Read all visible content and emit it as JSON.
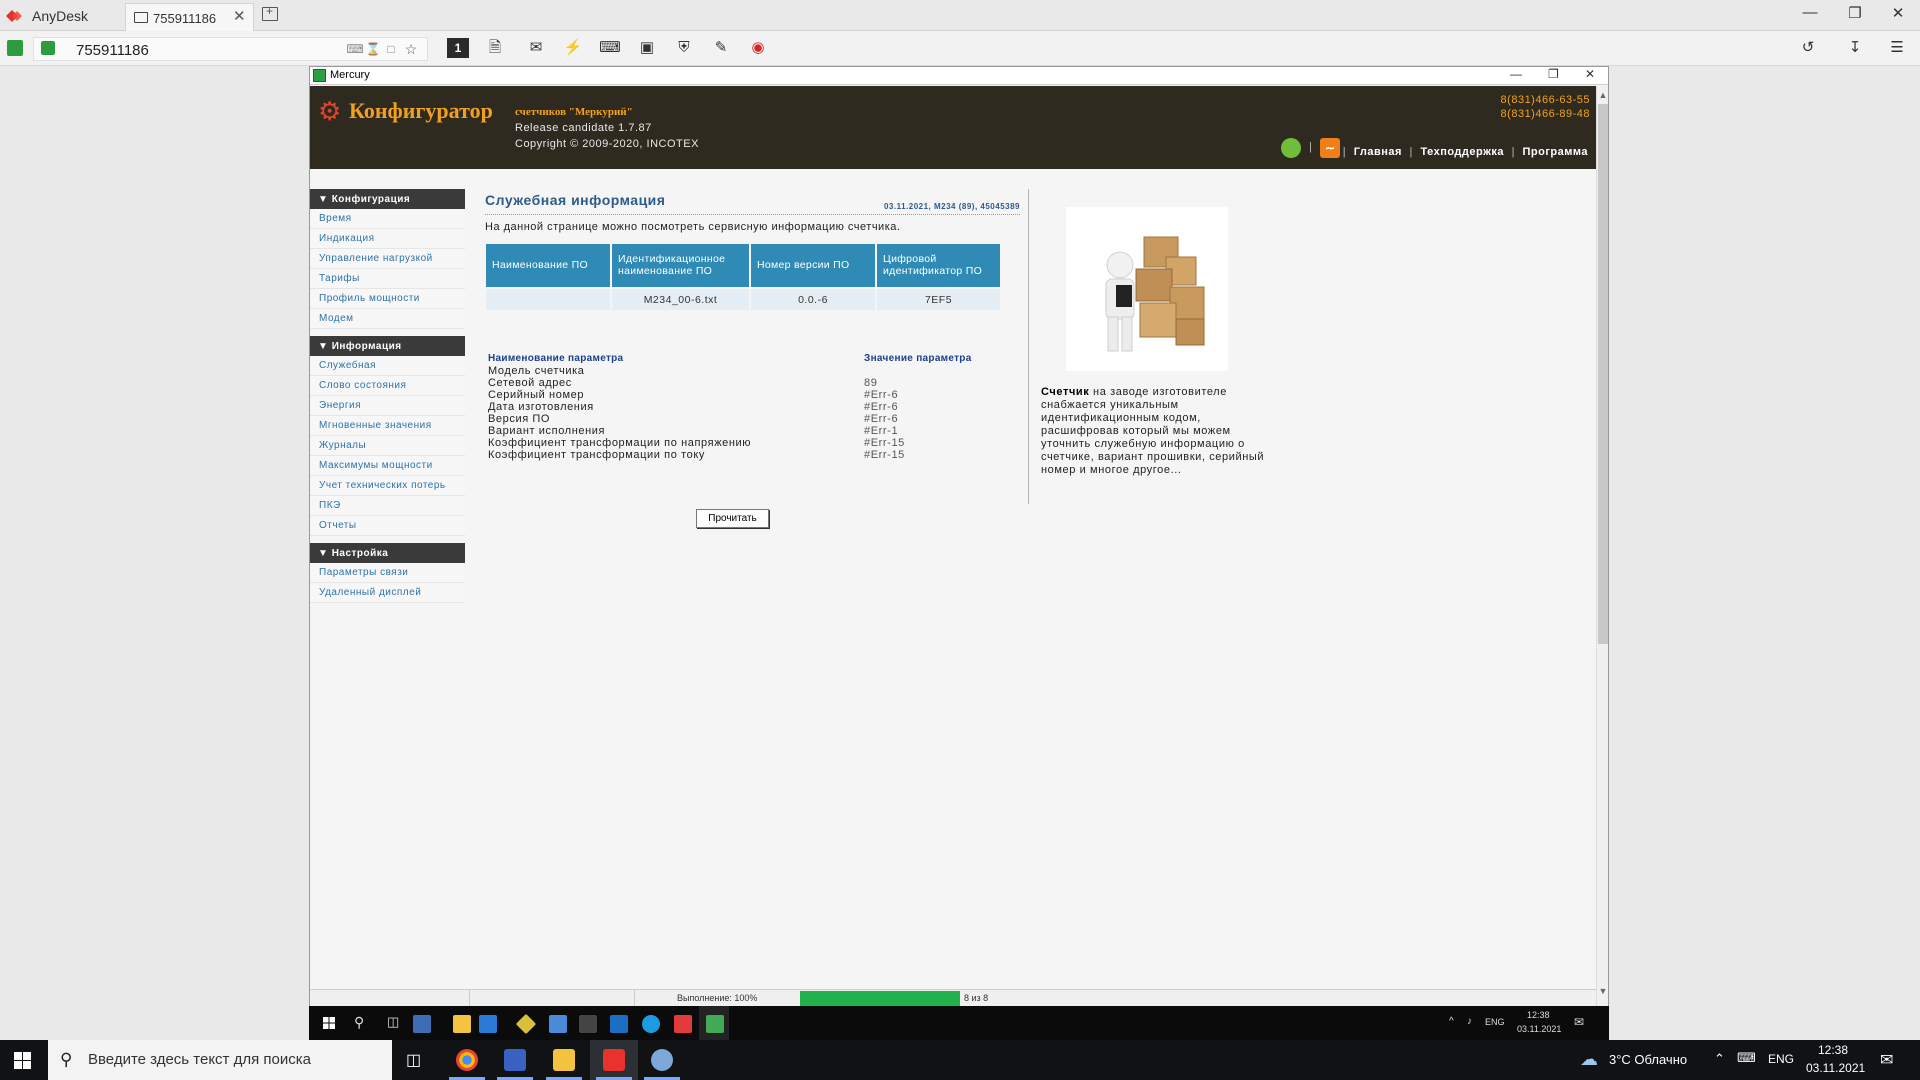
{
  "anydesk": {
    "app_name": "AnyDesk",
    "tab_label": "755911186",
    "tab_close": "✕",
    "address": "755911186"
  },
  "mercury": {
    "window_title": "Mercury",
    "brand": "Конфигуратор",
    "brand_sub": "счетчиков \"Меркурий\"",
    "release": "Release candidate 1.7.87",
    "copyright": "Copyright © 2009-2020, INCOTEX",
    "phone1": "8(831)466-63-55",
    "phone2": "8(831)466-89-48",
    "nav": [
      "Главная",
      "Техподдержка",
      "Программа"
    ],
    "sidebar": {
      "sections": [
        {
          "title": "Конфигурация",
          "items": [
            "Время",
            "Индикация",
            "Управление нагрузкой",
            "Тарифы",
            "Профиль мощности",
            "Модем"
          ]
        },
        {
          "title": "Информация",
          "items": [
            "Служебная",
            "Слово состояния",
            "Энергия",
            "Мгновенные значения",
            "Журналы",
            "Максимумы мощности",
            "Учет технических потерь",
            "ПКЭ",
            "Отчеты"
          ]
        },
        {
          "title": "Настройка",
          "items": [
            "Параметры связи",
            "Удаленный дисплей"
          ]
        }
      ]
    },
    "page": {
      "title": "Служебная информация",
      "meta": "03.11.2021, M234 (89), 45045389",
      "description": "На данной странице можно посмотреть сервисную информацию счетчика.",
      "sw_table": {
        "headers": [
          "Наименование ПО",
          "Идентификационное наименование ПО",
          "Номер версии ПО",
          "Цифровой идентификатор ПО"
        ],
        "row": [
          "",
          "M234_00-6.txt",
          "0.0.-6",
          "7EF5"
        ]
      },
      "params_header_name": "Наименование параметра",
      "params_header_value": "Значение параметра",
      "params": [
        {
          "name": "Модель счетчика",
          "value": ""
        },
        {
          "name": "Сетевой адрес",
          "value": "89"
        },
        {
          "name": "Серийный номер",
          "value": "#Err-6"
        },
        {
          "name": "Дата изготовления",
          "value": "#Err-6"
        },
        {
          "name": "Версия ПО",
          "value": "#Err-6"
        },
        {
          "name": "Вариант исполнения",
          "value": "#Err-1"
        },
        {
          "name": "Коэффициент трансформации по напряжению",
          "value": "#Err-15"
        },
        {
          "name": "Коэффициент трансформации по току",
          "value": "#Err-15"
        }
      ],
      "read_button": "Прочитать",
      "info_bold": "Счетчик",
      "info_text": " на заводе изготовителе снабжается уникальным идентификационным кодом, расшифровав который мы можем уточнить служебную информацию о счетчике, вариант прошивки, серийный номер и многое другое..."
    },
    "status": {
      "progress_label": "Выполнение: 100%",
      "progress": 1.0,
      "count": "8 из 8"
    }
  },
  "remote_tray": {
    "lang": "ENG",
    "time": "12:38",
    "date": "03.11.2021"
  },
  "taskbar": {
    "search_placeholder": "Введите здесь текст для поиска",
    "weather": "3°C  Облачно",
    "lang": "ENG",
    "time": "12:38",
    "date": "03.11.2021"
  },
  "colors": {
    "accent_orange": "#f2a01e",
    "table_header": "#2f8bb5",
    "link_blue": "#2e72a8",
    "progress_green": "#22b14c"
  }
}
